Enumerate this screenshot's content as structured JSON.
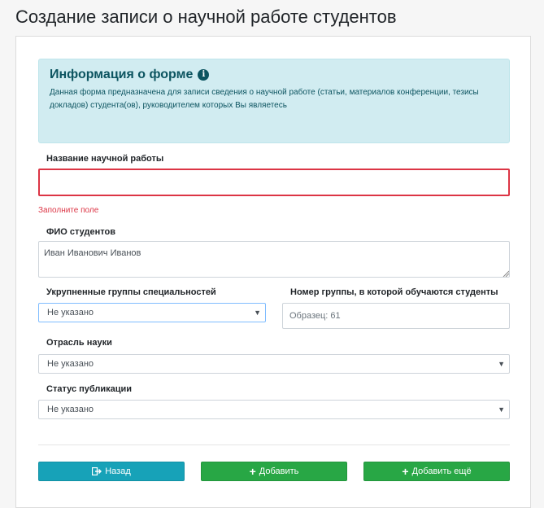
{
  "page_title": "Создание записи о научной работе студентов",
  "info": {
    "title": "Информация о форме",
    "text": "Данная форма предназначена для записи сведения о научной работе (статьи, материалов конференции, тезисы докладов) студента(ов), руководителем которых Вы являетесь"
  },
  "fields": {
    "work_title": {
      "label": "Название научной работы",
      "value": "",
      "error": "Заполните поле"
    },
    "students": {
      "label": "ФИО студентов",
      "value": "Иван Иванович Иванов"
    },
    "specialty_groups": {
      "label": "Укрупненные группы специальностей",
      "value": "Не указано"
    },
    "group_number": {
      "label": "Номер группы, в которой обучаются студенты",
      "placeholder": "Образец: 61"
    },
    "science_branch": {
      "label": "Отрасль науки",
      "value": "Не указано"
    },
    "publication_status": {
      "label": "Статус публикации",
      "value": "Не указано"
    }
  },
  "buttons": {
    "back": "Назад",
    "add": "Добавить",
    "add_more": "Добавить ещё"
  },
  "colors": {
    "info_bg": "#d1ecf1",
    "error": "#dc3545",
    "back_button": "#17a2b8",
    "add_button": "#28a745"
  }
}
